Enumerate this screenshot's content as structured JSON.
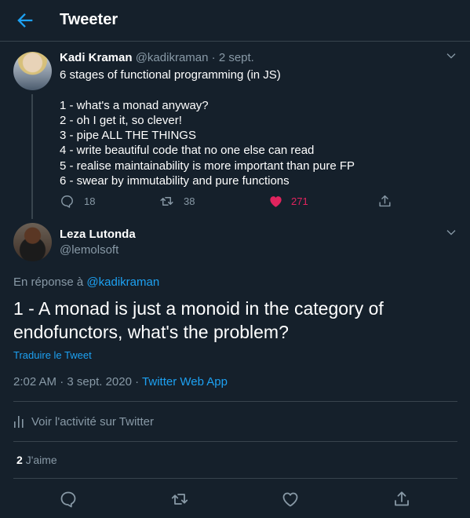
{
  "header": {
    "title": "Tweeter",
    "back_icon": "arrow-left-icon"
  },
  "parent_tweet": {
    "author_name": "Kadi Kraman",
    "author_handle": "@kadikraman",
    "separator": "·",
    "date": "2 sept.",
    "lines": [
      "6 stages of functional programming (in JS)",
      "",
      "1 - what's a monad anyway?",
      "2 - oh I get it, so clever!",
      "3 - pipe ALL THE THINGS",
      "4 - write beautiful code that no one else can read",
      "5 - realise maintainability is more important than pure FP",
      "6 - swear by immutability and pure functions"
    ],
    "reply_count": "18",
    "retweet_count": "38",
    "like_count": "271",
    "liked": true
  },
  "main_tweet": {
    "author_name": "Leza Lutonda",
    "author_handle": "@lemolsoft",
    "reply_prefix": "En réponse à",
    "reply_handle": "@kadikraman",
    "text": "1 - A monad is just a monoid in the category of endofunctors, what's the problem?",
    "translate_label": "Traduire le Tweet",
    "time": "2:02 AM",
    "date": "3 sept. 2020",
    "separator": "·",
    "source": "Twitter Web App",
    "activity_label": "Voir l'activité sur Twitter",
    "likes_count": "2",
    "likes_label": "J'aime"
  },
  "colors": {
    "background": "#15202b",
    "accent": "#1da1f2",
    "like": "#e0245e",
    "muted": "#8899a6",
    "border": "#38444d"
  }
}
